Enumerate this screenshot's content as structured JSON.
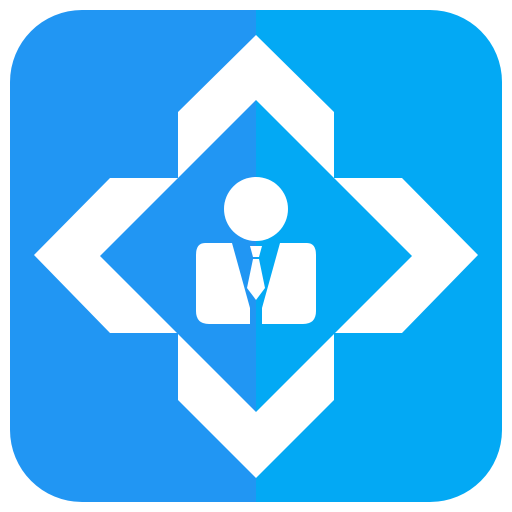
{
  "icon": {
    "name": "business-person-badge-icon",
    "colors": {
      "tile_left": "#2196F3",
      "tile_right": "#03A9F4",
      "emblem": "#FFFFFF",
      "background": "#FFFFFF"
    }
  }
}
